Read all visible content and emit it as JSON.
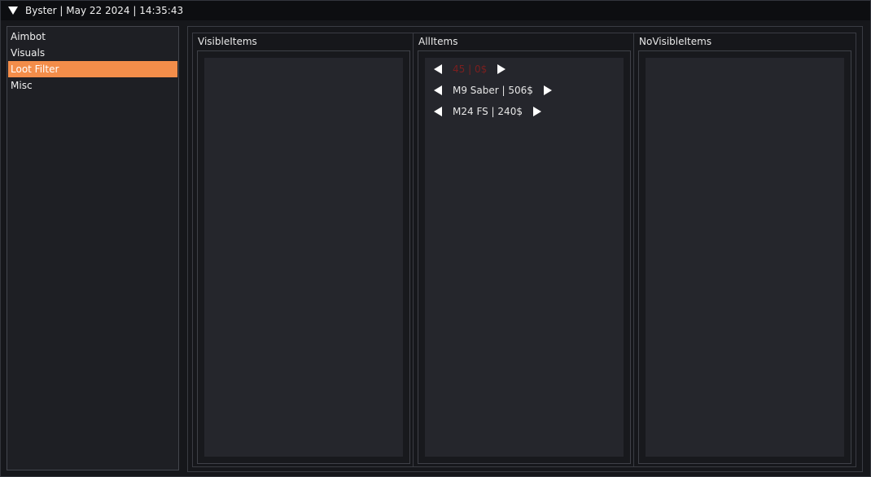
{
  "window": {
    "title": "Byster | May 22 2024 | 14:35:43"
  },
  "sidebar": {
    "items": [
      {
        "label": "Aimbot"
      },
      {
        "label": "Visuals"
      },
      {
        "label": "Loot Filter"
      },
      {
        "label": "Misc"
      }
    ],
    "active_index": 2
  },
  "columns": {
    "visible": {
      "header": "VisibleItems"
    },
    "all": {
      "header": "AllItems",
      "items": [
        {
          "label": "45 | 0$"
        },
        {
          "label": "M9 Saber | 506$"
        },
        {
          "label": "M24 FS | 240$"
        }
      ]
    },
    "novisible": {
      "header": "NoVisibleItems"
    }
  },
  "colors": {
    "accent": "#f38d4a",
    "background": "#16171b",
    "panel": "#25262c",
    "muted_item": "#7a1f1f"
  },
  "icons": {
    "collapse": "triangle-down-icon",
    "prev": "arrow-left-icon",
    "next": "arrow-right-icon"
  }
}
